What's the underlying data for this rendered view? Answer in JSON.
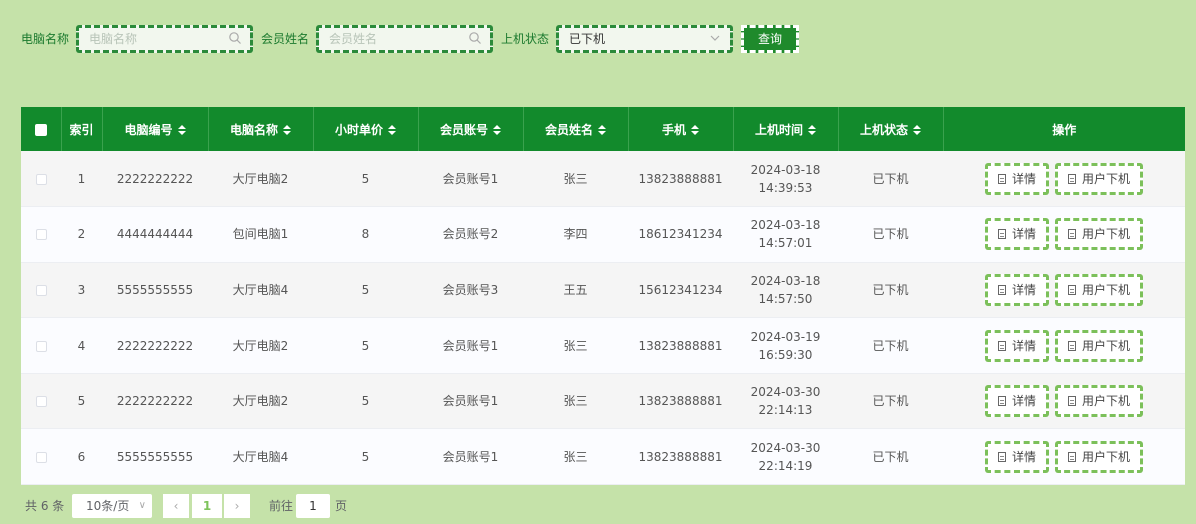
{
  "search": {
    "pc_name_label": "电脑名称",
    "pc_name_placeholder": "电脑名称",
    "member_name_label": "会员姓名",
    "member_name_placeholder": "会员姓名",
    "status_label": "上机状态",
    "status_value": "已下机",
    "query_label": "查询"
  },
  "table": {
    "headers": {
      "index": "索引",
      "pc_no": "电脑编号",
      "pc_name": "电脑名称",
      "hourly": "小时单价",
      "account": "会员账号",
      "member": "会员姓名",
      "phone": "手机",
      "time": "上机时间",
      "status": "上机状态",
      "ops": "操作"
    },
    "detail_label": "详情",
    "logout_label": "用户下机",
    "rows": [
      {
        "index": "1",
        "pc_no": "2222222222",
        "pc_name": "大厅电脑2",
        "hourly": "5",
        "account": "会员账号1",
        "member": "张三",
        "phone": "13823888881",
        "time": "2024-03-18 14:39:53",
        "status": "已下机"
      },
      {
        "index": "2",
        "pc_no": "4444444444",
        "pc_name": "包间电脑1",
        "hourly": "8",
        "account": "会员账号2",
        "member": "李四",
        "phone": "18612341234",
        "time": "2024-03-18 14:57:01",
        "status": "已下机"
      },
      {
        "index": "3",
        "pc_no": "5555555555",
        "pc_name": "大厅电脑4",
        "hourly": "5",
        "account": "会员账号3",
        "member": "王五",
        "phone": "15612341234",
        "time": "2024-03-18 14:57:50",
        "status": "已下机"
      },
      {
        "index": "4",
        "pc_no": "2222222222",
        "pc_name": "大厅电脑2",
        "hourly": "5",
        "account": "会员账号1",
        "member": "张三",
        "phone": "13823888881",
        "time": "2024-03-19 16:59:30",
        "status": "已下机"
      },
      {
        "index": "5",
        "pc_no": "2222222222",
        "pc_name": "大厅电脑2",
        "hourly": "5",
        "account": "会员账号1",
        "member": "张三",
        "phone": "13823888881",
        "time": "2024-03-30 22:14:13",
        "status": "已下机"
      },
      {
        "index": "6",
        "pc_no": "5555555555",
        "pc_name": "大厅电脑4",
        "hourly": "5",
        "account": "会员账号1",
        "member": "张三",
        "phone": "13823888881",
        "time": "2024-03-30 22:14:19",
        "status": "已下机"
      }
    ]
  },
  "pager": {
    "total": "共 6 条",
    "page_size": "10条/页",
    "prev": "‹",
    "current": "1",
    "next": "›",
    "goto_label": "前往",
    "goto_value": "1",
    "page_suffix": "页"
  },
  "colors": {
    "background": "#c5e2a9",
    "header": "#128a2c",
    "accent": "#1f8a2c"
  }
}
